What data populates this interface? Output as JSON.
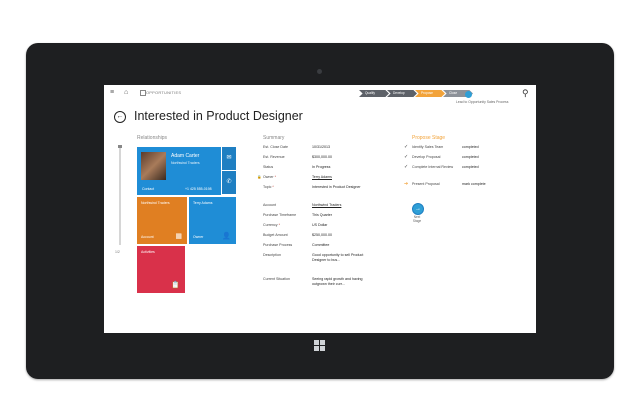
{
  "entity": "OPPORTUNITIES",
  "process": {
    "stages": [
      "Qualify",
      "Develop",
      "Propose",
      "Close"
    ],
    "active_stage": "Propose",
    "lead_link": "Lead to Opportunity Sales Process"
  },
  "title": "Interested in Product Designer",
  "relationships": {
    "heading": "Relationships",
    "zoom": "1/2",
    "contact": {
      "name": "Adam Carter",
      "company": "Northwind Traders",
      "role": "Contact",
      "phone": "+1 425 555-0198"
    },
    "account_tile": {
      "name": "Northwind Traders",
      "label": "Account"
    },
    "owner_tile": {
      "name": "Terry Adams",
      "label": "Owner"
    },
    "activities_tile": {
      "label": "Activities"
    }
  },
  "summary": {
    "heading": "Summary",
    "fields": [
      {
        "label": "Est. Close Date",
        "value": "10/31/2013"
      },
      {
        "label": "Est. Revenue",
        "value": "$300,000.00"
      },
      {
        "label": "Status",
        "value": "In Progress"
      },
      {
        "label": "Owner",
        "value": "Terry Adams",
        "required": true
      },
      {
        "label": "Topic",
        "value": "Interested in Product Designer",
        "required": true
      },
      {
        "label": "Account",
        "value": "Northwind Traders"
      },
      {
        "label": "Purchase Timeframe",
        "value": "This Quarter"
      },
      {
        "label": "Currency",
        "value": "US Dollar",
        "required": true
      },
      {
        "label": "Budget Amount",
        "value": "$250,000.00"
      },
      {
        "label": "Purchase Process",
        "value": "Committee"
      },
      {
        "label": "Description",
        "value": "Good opportunity to sell Product Designer to bus..."
      },
      {
        "label": "Current Situation",
        "value": "Seeing rapid growth and having outgrown their curr..."
      }
    ]
  },
  "propose_stage": {
    "heading": "Propose Stage",
    "tasks": [
      {
        "task": "Identify Sales Team",
        "status": "completed"
      },
      {
        "task": "Develop Proposal",
        "status": "completed"
      },
      {
        "task": "Complete Internal Review",
        "status": "completed"
      },
      {
        "task": "Present Proposal",
        "status": "mark complete"
      }
    ],
    "next_label": "Next Stage"
  },
  "colors": {
    "accent": "#1f8dd6",
    "orange": "#e07f22",
    "red": "#d9314a",
    "stage_active": "#f2a33a"
  }
}
